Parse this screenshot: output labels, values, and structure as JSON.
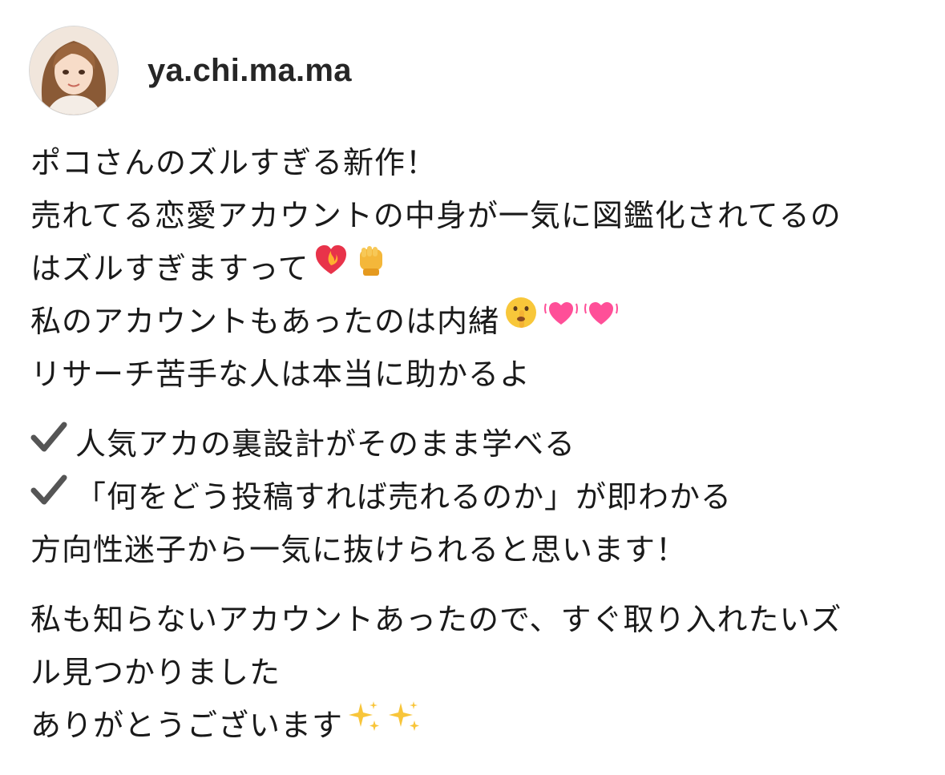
{
  "post": {
    "username": "ya.chi.ma.ma",
    "lines": {
      "l1": "ポコさんのズルすぎる新作！",
      "l2": "売れてる恋愛アカウントの中身が一気に図鑑化されてるの",
      "l3": "はズルすぎますって",
      "l4": "私のアカウントもあったのは内緒",
      "l5": "リサーチ苦手な人は本当に助かるよ",
      "l6": "人気アカの裏設計がそのまま学べる",
      "l7": "「何をどう投稿すれば売れるのか」が即わかる",
      "l8": "方向性迷子から一気に抜けられると思います！",
      "l9": "私も知らないアカウントあったので、すぐ取り入れたいズ",
      "l10": "ル見つかりました",
      "l11": "ありがとうございます"
    },
    "emojis": {
      "l3": [
        "heart-on-fire-icon",
        "raised-fist-icon"
      ],
      "l4": [
        "shushing-face-icon",
        "beating-heart-icon",
        "beating-heart-icon"
      ],
      "l6": [
        "check-mark-icon"
      ],
      "l7": [
        "check-mark-icon"
      ],
      "l11": [
        "sparkles-icon",
        "sparkles-icon"
      ]
    }
  }
}
